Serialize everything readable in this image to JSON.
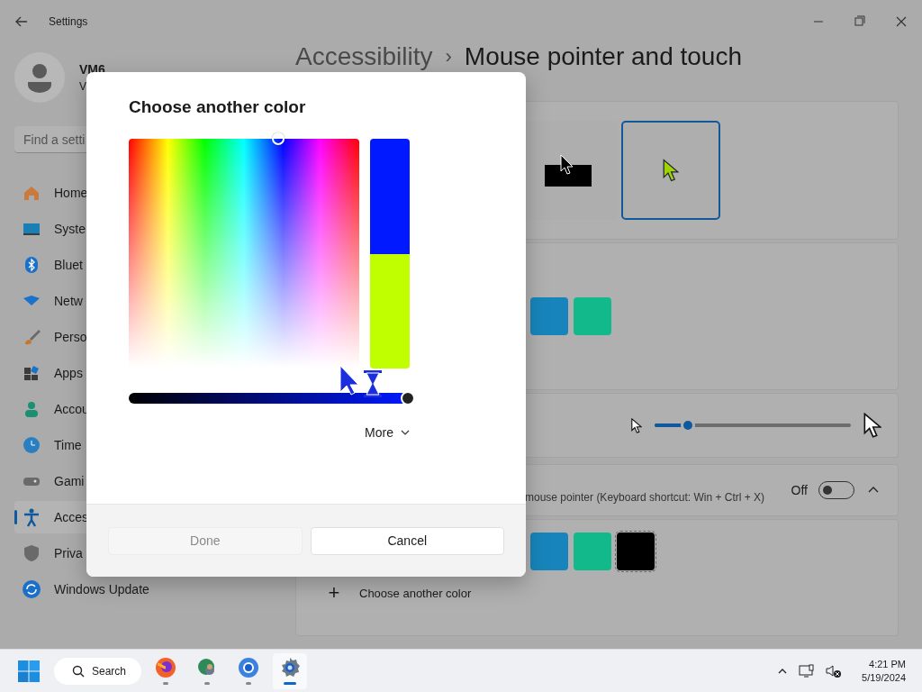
{
  "window": {
    "title": "Settings"
  },
  "profile": {
    "name": "VM6",
    "subtitle": "V"
  },
  "search": {
    "placeholder": "Find a setti"
  },
  "sidebar": {
    "items": [
      {
        "label": "Home",
        "selected": false
      },
      {
        "label": "Syste",
        "selected": false
      },
      {
        "label": "Bluet",
        "selected": false
      },
      {
        "label": "Netw",
        "selected": false
      },
      {
        "label": "Perso",
        "selected": false
      },
      {
        "label": "Apps",
        "selected": false
      },
      {
        "label": "Accou",
        "selected": false
      },
      {
        "label": "Time",
        "selected": false
      },
      {
        "label": "Gami",
        "selected": false
      },
      {
        "label": "Acces",
        "selected": true
      },
      {
        "label": "Priva",
        "selected": false
      },
      {
        "label": "Windows Update",
        "selected": false
      }
    ]
  },
  "header": {
    "breadcrumb": "Accessibility",
    "separator": "›",
    "title": "Mouse pointer and touch"
  },
  "pointer_styles": [
    {
      "kind": "inverted",
      "selected": false
    },
    {
      "kind": "custom",
      "selected": true
    }
  ],
  "pointer_colors": [
    {
      "color": "#1785bb",
      "selected": false
    },
    {
      "color": "#12b98b",
      "selected": false
    }
  ],
  "size": {
    "level": 0.17
  },
  "indicator": {
    "description": "mouse pointer (Keyboard shortcut: Win + Ctrl + X)",
    "state_label": "Off",
    "on": false,
    "expanded": true
  },
  "indicator_colors": [
    {
      "color": "#1785bb",
      "selected": false
    },
    {
      "color": "#12b98b",
      "selected": false
    },
    {
      "color": "#000000",
      "selected": true
    }
  ],
  "add_color": {
    "icon": "+",
    "label": "Choose another color"
  },
  "dialog": {
    "title": "Choose another color",
    "spectrum": {
      "level": 0.65
    },
    "preview": [
      {
        "kind": "new",
        "color": "#0019ff"
      },
      {
        "kind": "old",
        "color": "#bfff00"
      }
    ],
    "value_slider": {
      "level": 1.0
    },
    "more": "More",
    "buttons": [
      {
        "label": "Done",
        "disabled": true
      },
      {
        "label": "Cancel",
        "disabled": false
      }
    ]
  },
  "taskbar": {
    "search": "Search",
    "apps": [
      {
        "kind": "fox",
        "selected": false
      },
      {
        "kind": "globe",
        "selected": false
      },
      {
        "kind": "browser",
        "selected": false
      },
      {
        "kind": "settings",
        "selected": true
      }
    ],
    "time": "4:21 PM",
    "date": "5/19/2024"
  }
}
